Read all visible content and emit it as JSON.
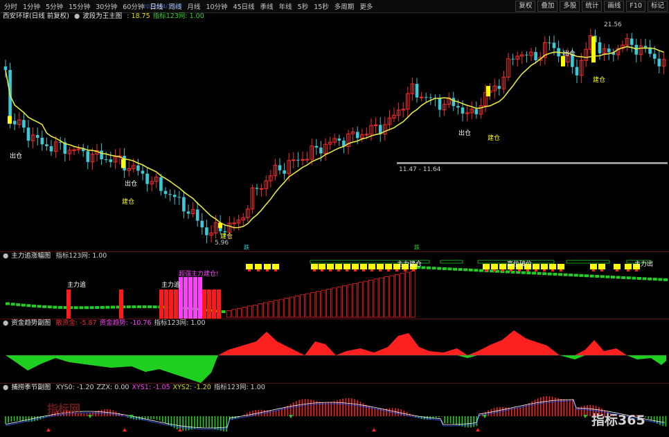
{
  "toolbar": {
    "period_buttons": [
      "分时",
      "1分钟",
      "5分钟",
      "15分钟",
      "30分钟",
      "60分钟",
      "日线",
      "周线",
      "月线",
      "10分钟",
      "45日线",
      "季线",
      "年线",
      "5秒",
      "15秒",
      "多周期",
      "更多"
    ],
    "active_period": "日线",
    "right_buttons": [
      "复权",
      "叠加",
      "多股",
      "统计",
      "画线",
      "F10",
      "标记"
    ],
    "date_tag": "2022/04/14/四"
  },
  "main_panel": {
    "left_label": "西安环球(日线 前复权)",
    "indicator_name": "波段为王主图",
    "values": [
      {
        "text": ": 18.75",
        "color": "#e0e000"
      },
      {
        "text": "指标123网: 1.00",
        "color": "#30d030"
      }
    ],
    "annotations": {
      "max_price": "21.56",
      "min_price": "5.96",
      "hline_label": "11.47 - 11.64",
      "sell_label": "出仓",
      "buy_label": "建仓",
      "date_marker_1": "跌",
      "date_marker_2": "跌"
    }
  },
  "panel2": {
    "title": "主力追涨幅图",
    "values": [
      {
        "text": "指标123网: 1.00",
        "color": "#d0d0d0"
      }
    ],
    "annotations": {
      "main_chase_1": "主力追",
      "main_chase_2": "主力追",
      "super_strong": "超强主力建仓!",
      "main_chase_3": "主力建仓",
      "top_label_1": "高位破位",
      "top_label_2": "主力出"
    }
  },
  "panel3": {
    "title": "资金趋势副图",
    "values": [
      {
        "text": "散资金: -5.87",
        "color": "#e03030"
      },
      {
        "text": "资金趋势: -10.76",
        "color": "#ff40ff"
      },
      {
        "text": "指标123网: 1.00",
        "color": "#d0d0d0"
      }
    ]
  },
  "panel4": {
    "title": "捕捞季节副图",
    "values": [
      {
        "text": "XYS0: -1.20",
        "color": "#d0d0d0"
      },
      {
        "text": "ZZX: 0.00",
        "color": "#d0d0d0"
      },
      {
        "text": "XYS1: -1.05",
        "color": "#ff40ff"
      },
      {
        "text": "XYS2: -1.20",
        "color": "#e0e000"
      },
      {
        "text": "指标123网: 1.00",
        "color": "#d0d0d0"
      }
    ]
  },
  "watermarks": {
    "left": "指标网",
    "right": "指标365"
  },
  "colors": {
    "up": "#ff2a2a",
    "down": "#3cc8d6",
    "ma": "#e8e840",
    "bull": "#ff2020",
    "bear": "#20d020",
    "accent": "#ff40ff"
  }
}
